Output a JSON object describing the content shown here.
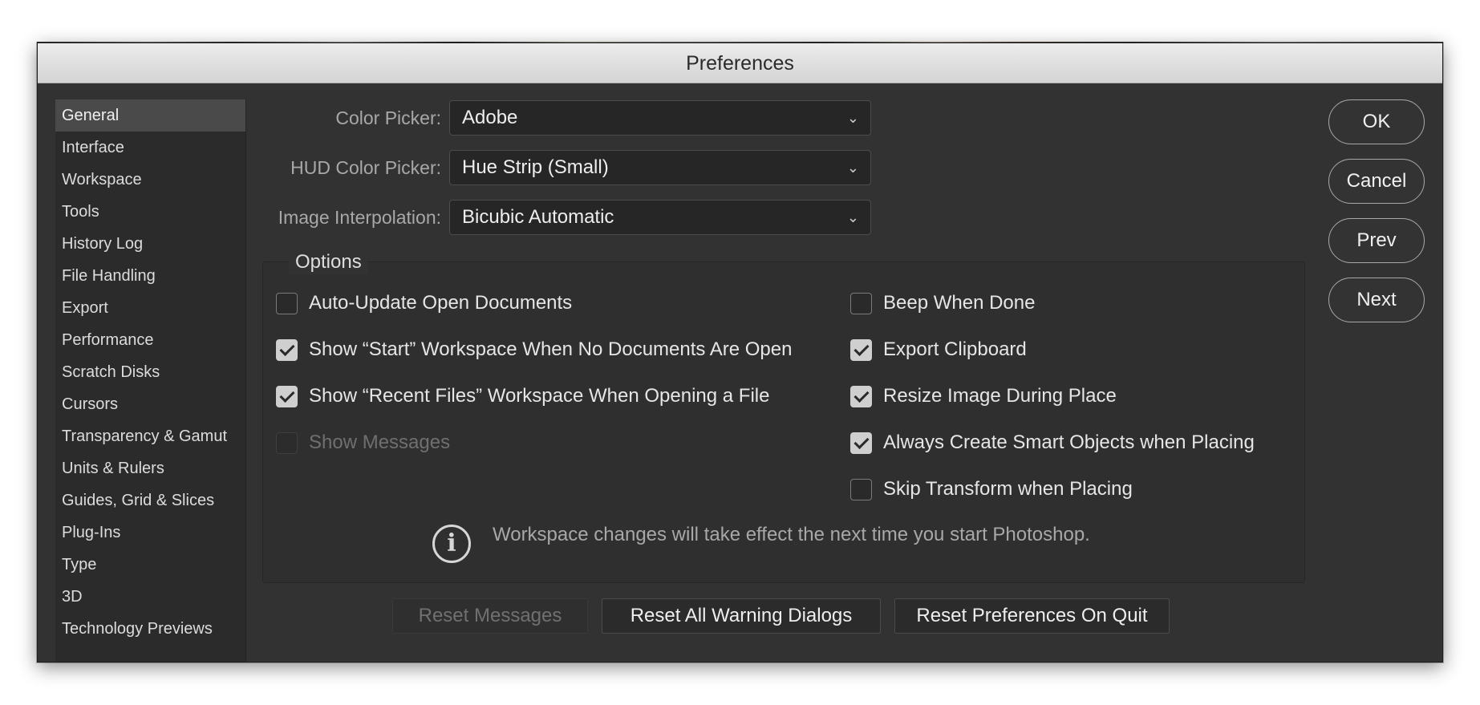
{
  "window": {
    "title": "Preferences"
  },
  "sidebar": {
    "items": [
      {
        "label": "General",
        "active": true
      },
      {
        "label": "Interface"
      },
      {
        "label": "Workspace"
      },
      {
        "label": "Tools"
      },
      {
        "label": "History Log"
      },
      {
        "label": "File Handling"
      },
      {
        "label": "Export"
      },
      {
        "label": "Performance"
      },
      {
        "label": "Scratch Disks"
      },
      {
        "label": "Cursors"
      },
      {
        "label": "Transparency & Gamut"
      },
      {
        "label": "Units & Rulers"
      },
      {
        "label": "Guides, Grid & Slices"
      },
      {
        "label": "Plug-Ins"
      },
      {
        "label": "Type"
      },
      {
        "label": "3D"
      },
      {
        "label": "Technology Previews"
      }
    ]
  },
  "fields": {
    "color_picker": {
      "label": "Color Picker:",
      "value": "Adobe"
    },
    "hud_color_picker": {
      "label": "HUD Color Picker:",
      "value": "Hue Strip (Small)"
    },
    "image_interpolation": {
      "label": "Image Interpolation:",
      "value": "Bicubic Automatic"
    }
  },
  "options": {
    "legend": "Options",
    "left": [
      {
        "label": "Auto-Update Open Documents",
        "checked": false,
        "disabled": false
      },
      {
        "label": "Show “Start” Workspace When No Documents Are Open",
        "checked": true,
        "disabled": false
      },
      {
        "label": "Show “Recent Files” Workspace When Opening a File",
        "checked": true,
        "disabled": false
      },
      {
        "label": "Show Messages",
        "checked": false,
        "disabled": true
      }
    ],
    "right": [
      {
        "label": "Beep When Done",
        "checked": false
      },
      {
        "label": "Export Clipboard",
        "checked": true
      },
      {
        "label": "Resize Image During Place",
        "checked": true
      },
      {
        "label": "Always Create Smart Objects when Placing",
        "checked": true
      },
      {
        "label": "Skip Transform when Placing",
        "checked": false
      }
    ],
    "info": "Workspace changes will take effect the next time you start Photoshop."
  },
  "bottom_buttons": {
    "reset_messages": "Reset Messages",
    "reset_warnings": "Reset All Warning Dialogs",
    "reset_prefs": "Reset Preferences On Quit"
  },
  "side_buttons": {
    "ok": "OK",
    "cancel": "Cancel",
    "prev": "Prev",
    "next": "Next"
  },
  "icons": {
    "dropdown": "chevron-down-icon",
    "info": "info-icon"
  }
}
